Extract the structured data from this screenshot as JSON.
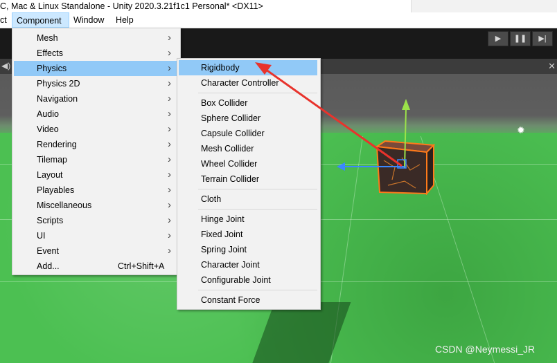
{
  "window": {
    "title": "C, Mac & Linux Standalone - Unity 2020.3.21f1c1 Personal* <DX11>"
  },
  "menubar": {
    "items": [
      "ct",
      "Component",
      "Window",
      "Help"
    ]
  },
  "toolbar": {
    "play": "▶",
    "pause": "❚❚",
    "step": "▶|"
  },
  "component_menu": {
    "items": [
      {
        "label": "Mesh",
        "submenu": true
      },
      {
        "label": "Effects",
        "submenu": true
      },
      {
        "label": "Physics",
        "submenu": true,
        "highlighted": true
      },
      {
        "label": "Physics 2D",
        "submenu": true
      },
      {
        "label": "Navigation",
        "submenu": true
      },
      {
        "label": "Audio",
        "submenu": true
      },
      {
        "label": "Video",
        "submenu": true
      },
      {
        "label": "Rendering",
        "submenu": true
      },
      {
        "label": "Tilemap",
        "submenu": true
      },
      {
        "label": "Layout",
        "submenu": true
      },
      {
        "label": "Playables",
        "submenu": true
      },
      {
        "label": "Miscellaneous",
        "submenu": true
      },
      {
        "label": "Scripts",
        "submenu": true
      },
      {
        "label": "UI",
        "submenu": true
      },
      {
        "label": "Event",
        "submenu": true
      },
      {
        "label": "Add...",
        "shortcut": "Ctrl+Shift+A"
      }
    ]
  },
  "physics_menu": {
    "groups": [
      [
        "Rigidbody",
        "Character Controller"
      ],
      [
        "Box Collider",
        "Sphere Collider",
        "Capsule Collider",
        "Mesh Collider",
        "Wheel Collider",
        "Terrain Collider"
      ],
      [
        "Cloth"
      ],
      [
        "Hinge Joint",
        "Fixed Joint",
        "Spring Joint",
        "Character Joint",
        "Configurable Joint"
      ],
      [
        "Constant Force"
      ]
    ],
    "highlighted": "Rigidbody"
  },
  "watermark": "CSDN @Neymessi_JR",
  "colors": {
    "menu_bg": "#f2f2f2",
    "menu_highlight": "#91c9f7",
    "active_menubar": "#cce8ff",
    "annotation_arrow": "#e8332c",
    "ground": "#4cc052"
  },
  "icons": {
    "arrow": "submenu-arrow-icon",
    "sun": "sun-icon",
    "tools": "tools-icon"
  }
}
